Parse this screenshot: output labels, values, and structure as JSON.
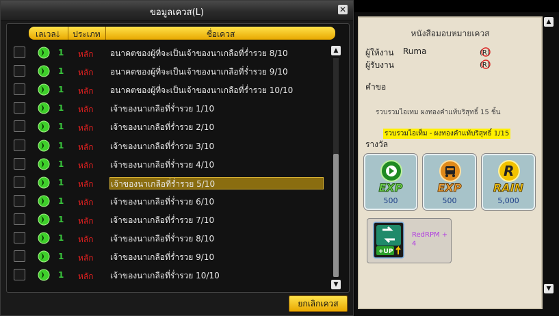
{
  "left_window": {
    "title": "ขอมูลเควส(L)",
    "close": "✕",
    "columns": {
      "level": "เลเวล",
      "type": "ประเภท",
      "name": "ชื่อเควส"
    },
    "cancel_button": "ยกเลิกเควส",
    "selected_index": 7,
    "rows": [
      {
        "level": "1",
        "type": "หลัก",
        "name": "อนาคตของผู้ที่จะเป็นเจ้าของนาเกลือที่ร่ำรวย 8/10"
      },
      {
        "level": "1",
        "type": "หลัก",
        "name": "อนาคตของผู้ที่จะเป็นเจ้าของนาเกลือที่ร่ำรวย 9/10"
      },
      {
        "level": "1",
        "type": "หลัก",
        "name": "อนาคตของผู้ที่จะเป็นเจ้าของนาเกลือที่ร่ำรวย 10/10"
      },
      {
        "level": "1",
        "type": "หลัก",
        "name": "เจ้าของนาเกลือที่ร่ำรวย 1/10"
      },
      {
        "level": "1",
        "type": "หลัก",
        "name": "เจ้าของนาเกลือที่ร่ำรวย 2/10"
      },
      {
        "level": "1",
        "type": "หลัก",
        "name": "เจ้าของนาเกลือที่ร่ำรวย 3/10"
      },
      {
        "level": "1",
        "type": "หลัก",
        "name": "เจ้าของนาเกลือที่ร่ำรวย 4/10"
      },
      {
        "level": "1",
        "type": "หลัก",
        "name": "เจ้าของนาเกลือที่ร่ำรวย 5/10"
      },
      {
        "level": "1",
        "type": "หลัก",
        "name": "เจ้าของนาเกลือที่ร่ำรวย 6/10"
      },
      {
        "level": "1",
        "type": "หลัก",
        "name": "เจ้าของนาเกลือที่ร่ำรวย 7/10"
      },
      {
        "level": "1",
        "type": "หลัก",
        "name": "เจ้าของนาเกลือที่ร่ำรวย 8/10"
      },
      {
        "level": "1",
        "type": "หลัก",
        "name": "เจ้าของนาเกลือที่ร่ำรวย 9/10"
      },
      {
        "level": "1",
        "type": "หลัก",
        "name": "เจ้าของนาเกลือที่ร่ำรวย 10/10"
      }
    ]
  },
  "right_window": {
    "title": "หนังสือมอบหมายเควส",
    "giver_label": "ผู้ให้งาน",
    "giver_name": "Ruma",
    "receiver_label": "ผู้รับงาน",
    "request_label": "คำขอ",
    "request_text": "รวบรวมไอเทม ผงทองคำแท้บริสุทธิ์ 15 ชิ้น",
    "progress_text": "รวบรวมไอเท็ม - ผงทองคำแท้บริสุทธิ์ 1/15",
    "reward_label": "รางวัล",
    "rewards": [
      {
        "name": "EXP",
        "value": "500"
      },
      {
        "name": "EXP",
        "value": "500"
      },
      {
        "name": "RAIN",
        "value": "5,000"
      }
    ],
    "item_reward": {
      "name": "RedRPM +",
      "qty": "4",
      "badge": "+UP"
    },
    "icon_letter": "R"
  },
  "colors": {
    "accent_yellow": "#f2c200",
    "level_green": "#39c43c",
    "type_red": "#e22020",
    "paper": "#e8e0ce"
  }
}
